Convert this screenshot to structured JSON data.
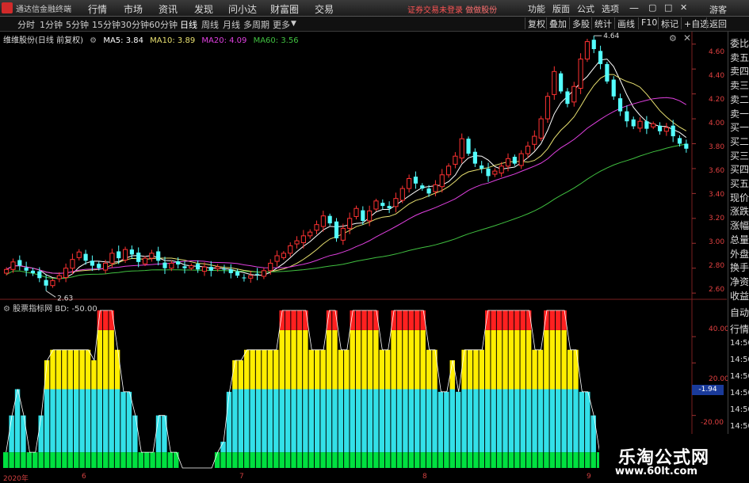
{
  "menubar": {
    "app_title": "通达信金融终端",
    "items": [
      "行情",
      "市场",
      "资讯",
      "发现",
      "问小达",
      "财富圈",
      "交易"
    ],
    "login_warning": "证券交易未登录",
    "login_link": "做做股份",
    "right_items": [
      "功能",
      "版面",
      "公式",
      "选项"
    ],
    "guest": "游客"
  },
  "tabbar": {
    "periods": [
      "分时",
      "1分钟",
      "5分钟",
      "15分钟",
      "30分钟",
      "60分钟",
      "日线",
      "周线",
      "月线",
      "多周期",
      "更多"
    ],
    "active": "日线",
    "right_buttons": [
      "复权",
      "叠加",
      "多股",
      "统计",
      "画线",
      "F10",
      "标记",
      "+自选",
      "返回"
    ]
  },
  "chart_header": {
    "stock": "维维股份(日线 前复权)",
    "ma5": "MA5: 3.84",
    "ma10": "MA10: 3.89",
    "ma20": "MA20: 4.09",
    "ma60": "MA60: 3.56"
  },
  "indicator_header": {
    "name": "股票指标网",
    "value": "BD: -50.00"
  },
  "right_panel": [
    "委比",
    "卖五",
    "卖四",
    "卖三",
    "卖二",
    "卖一",
    "买一",
    "买二",
    "买三",
    "买四",
    "买五",
    "现价",
    "涨跌",
    "涨幅",
    "总量",
    "外盘",
    "换手",
    "净资",
    "收益"
  ],
  "right_panel2": [
    "自动",
    "行情",
    "14:50",
    "14:50",
    "14:50",
    "14:50",
    "14:50",
    "14:50",
    "14:50"
  ],
  "colors": {
    "up": "#ff3232",
    "down": "#54ffff",
    "ma5": "#ffffff",
    "ma10": "#e8e070",
    "ma20": "#e040e0",
    "ma60": "#40c040",
    "bd_red": "#ff2020",
    "bd_yellow": "#ffee00",
    "bd_cyan": "#33e0e8",
    "bd_green": "#00e040"
  },
  "price_axis": {
    "ticks": [
      "4.60",
      "4.40",
      "4.20",
      "4.00",
      "3.80",
      "3.60",
      "3.40",
      "3.20",
      "3.00",
      "2.80",
      "2.60"
    ],
    "high_label": "4.64",
    "low_label": "2.63"
  },
  "indicator_axis": {
    "ticks": [
      "40.00",
      "20.00",
      "-20.00"
    ],
    "current": "-1.94"
  },
  "x_axis": [
    "2020年",
    "6",
    "7",
    "8",
    "9"
  ],
  "watermark": {
    "title": "乐淘公式网",
    "url": "www.60lt.com"
  },
  "chart_data": {
    "type": "candlestick",
    "title": "维维股份(日线 前复权)",
    "price_range": [
      2.55,
      4.7
    ],
    "high": 4.64,
    "low": 2.63,
    "ma_latest": {
      "MA5": 3.84,
      "MA10": 3.89,
      "MA20": 4.09,
      "MA60": 3.56
    },
    "closes": [
      2.79,
      2.85,
      2.82,
      2.78,
      2.76,
      2.72,
      2.66,
      2.7,
      2.74,
      2.8,
      2.87,
      2.93,
      2.86,
      2.82,
      2.8,
      2.84,
      2.92,
      2.88,
      2.95,
      2.91,
      2.85,
      2.88,
      2.92,
      2.86,
      2.8,
      2.84,
      2.83,
      2.8,
      2.82,
      2.79,
      2.81,
      2.78,
      2.81,
      2.79,
      2.76,
      2.74,
      2.72,
      2.74,
      2.75,
      2.78,
      2.84,
      2.9,
      2.92,
      2.98,
      3.02,
      3.06,
      3.09,
      3.15,
      3.22,
      3.16,
      3.04,
      3.12,
      3.2,
      3.28,
      3.18,
      3.26,
      3.34,
      3.3,
      3.28,
      3.36,
      3.44,
      3.52,
      3.48,
      3.44,
      3.4,
      3.47,
      3.55,
      3.62,
      3.7,
      3.84,
      3.72,
      3.64,
      3.6,
      3.54,
      3.58,
      3.62,
      3.68,
      3.64,
      3.72,
      3.78,
      3.86,
      4.0,
      4.18,
      4.38,
      4.22,
      4.12,
      4.26,
      4.48,
      4.62,
      4.56,
      4.44,
      4.3,
      4.18,
      4.06,
      3.98,
      3.94,
      3.98,
      3.92,
      3.96,
      3.9,
      3.93,
      3.86,
      3.8,
      3.76
    ],
    "indicator": {
      "name": "BD",
      "latest": -50.0,
      "range": [
        -60,
        60
      ],
      "levels": [
        -48,
        -20,
        0,
        -20,
        -48,
        -48,
        -20,
        22,
        30,
        30,
        30,
        30,
        30,
        30,
        30,
        22,
        45,
        45,
        45,
        30,
        -2,
        -2,
        -20,
        -48,
        -48,
        -48,
        -20,
        -20,
        -48,
        -48,
        -60,
        -60,
        -60,
        -60,
        -60,
        -60,
        -48,
        -40,
        -2,
        22,
        22,
        30,
        30,
        30,
        30,
        30,
        30,
        45,
        45,
        45,
        45,
        45,
        30,
        30,
        30,
        45,
        45,
        30,
        30,
        45,
        45,
        45,
        45,
        45,
        30,
        30,
        45,
        45,
        45,
        45,
        45,
        45,
        30,
        30,
        -2,
        -2,
        22,
        -2,
        30,
        30,
        30,
        30,
        45,
        45,
        45,
        45,
        45,
        45,
        45,
        45,
        30,
        30,
        45,
        45,
        45,
        45,
        30,
        30,
        -2,
        -2,
        -20,
        -48,
        -48,
        -48,
        -48,
        -50
      ]
    }
  }
}
